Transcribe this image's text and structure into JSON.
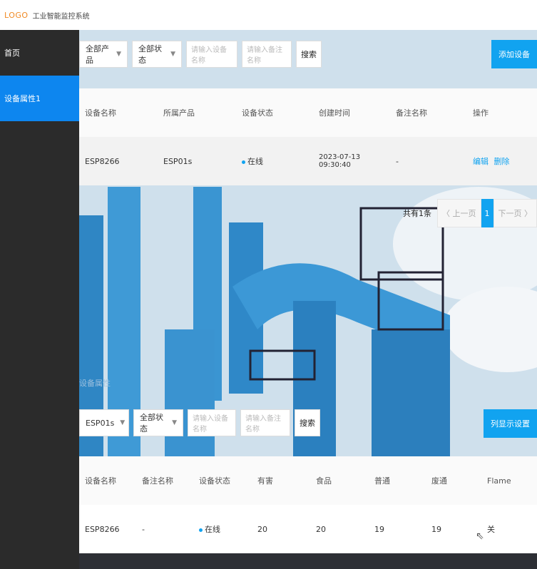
{
  "header": {
    "logo": "LOGO",
    "title": "工业智能监控系统"
  },
  "sidebar": {
    "items": [
      {
        "label": "首页"
      },
      {
        "label": "设备属性1"
      }
    ]
  },
  "device_panel": {
    "filter_product": "全部产品",
    "filter_status": "全部状态",
    "search_name_placeholder": "请输入设备名称",
    "search_remark_placeholder": "请输入备注名称",
    "search_label": "搜索",
    "add_label": "添加设备",
    "columns": [
      "设备名称",
      "所属产品",
      "设备状态",
      "创建时间",
      "备注名称",
      "操作"
    ],
    "rows": [
      {
        "name": "ESP8266",
        "product": "ESP01s",
        "status": "在线",
        "created": "2023-07-13 09:30:40",
        "remark": "-",
        "edit": "编辑",
        "delete": "删除"
      }
    ],
    "pager": {
      "total": "共有1条",
      "prev": "〈 上一页",
      "page": "1",
      "next": "下一页 〉"
    }
  },
  "attr_panel": {
    "title": "设备属性",
    "filter_product": "ESP01s",
    "filter_status": "全部状态",
    "search_name_placeholder": "请输入设备名称",
    "search_remark_placeholder": "请输入备注名称",
    "search_label": "搜索",
    "config_label": "列显示设置",
    "columns": [
      "设备名称",
      "备注名称",
      "设备状态",
      "有害",
      "食品",
      "普通",
      "废通",
      "Flame"
    ],
    "rows": [
      {
        "name": "ESP8266",
        "remark": "-",
        "status": "在线",
        "c1": "20",
        "c2": "20",
        "c3": "19",
        "c4": "19",
        "c5": "关"
      }
    ]
  },
  "colors": {
    "accent": "#11a3f0",
    "sidebar_bg": "#2b2b2b",
    "sidebar_active": "#0d86ef",
    "logo": "#f08a24"
  }
}
